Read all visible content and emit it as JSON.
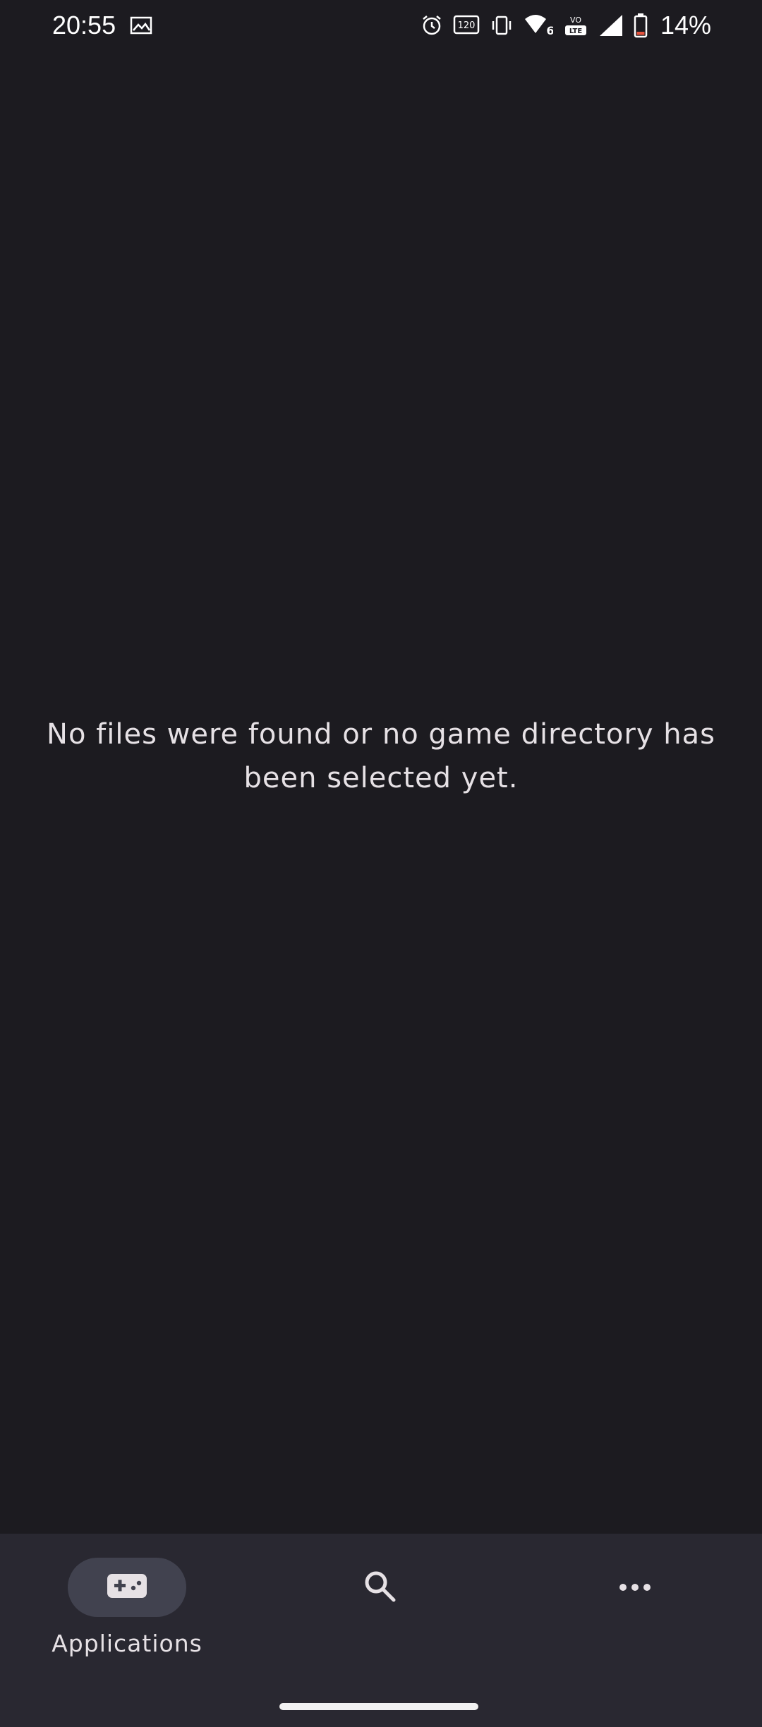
{
  "status_bar": {
    "time": "20:55",
    "battery_percent": "14%",
    "icons": [
      "image-icon",
      "alarm-icon",
      "refresh-rate-120hz-icon",
      "vibrate-icon",
      "wifi-6-icon",
      "volte-lte-icon",
      "signal-icon",
      "battery-icon"
    ],
    "refresh_rate": "120",
    "wifi_gen": "6",
    "volte_top": "VO",
    "volte_bottom": "LTE"
  },
  "main": {
    "empty_message": "No files were found or no game directory has been selected yet."
  },
  "bottom_nav": {
    "items": [
      {
        "label": "Applications",
        "icon": "gamepad-icon",
        "selected": true
      },
      {
        "label": "",
        "icon": "search-icon",
        "selected": false
      },
      {
        "label": "",
        "icon": "more-horizontal-icon",
        "selected": false
      }
    ]
  },
  "colors": {
    "background": "#1c1b20",
    "nav_background": "#292831",
    "indicator": "#41424f",
    "text": "#e6e1e5",
    "battery_low": "#e5533d"
  }
}
